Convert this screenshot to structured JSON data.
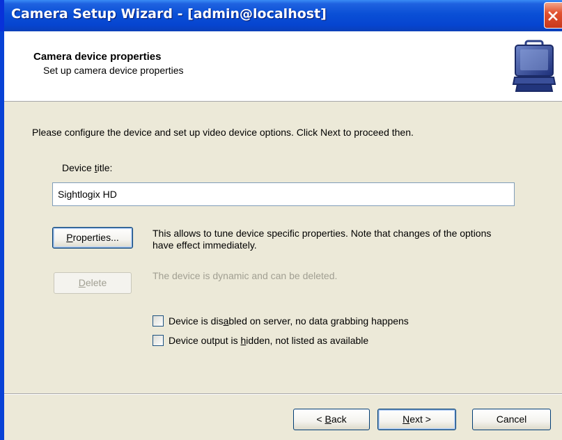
{
  "window": {
    "title": "Camera Setup Wizard - [admin@localhost]"
  },
  "header": {
    "title": "Camera device properties",
    "subtitle": "Set up camera device properties",
    "icon": "camera-case-icon"
  },
  "intro_text": "Please configure the device and set up video device options. Click Next to proceed then.",
  "device_title": {
    "label_prefix": "Device ",
    "label_mnemonic": "t",
    "label_suffix": "itle:",
    "value": "Sightlogix HD"
  },
  "properties": {
    "button_mnemonic": "P",
    "button_rest": "roperties...",
    "description": "This allows to tune device specific properties. Note that changes of the options have effect immediately."
  },
  "delete": {
    "button_mnemonic": "D",
    "button_rest": "elete",
    "description": "The device is dynamic and can be deleted."
  },
  "options": [
    {
      "prefix": "Device is dis",
      "mnemonic": "a",
      "suffix": "bled on server, no data grabbing happens",
      "checked": false
    },
    {
      "prefix": "Device output is ",
      "mnemonic": "h",
      "suffix": "idden, not listed as available",
      "checked": false
    }
  ],
  "footer": {
    "back_prefix": "< ",
    "back_mnemonic": "B",
    "back_rest": "ack",
    "next_mnemonic": "N",
    "next_rest": "ext >",
    "cancel": "Cancel"
  }
}
